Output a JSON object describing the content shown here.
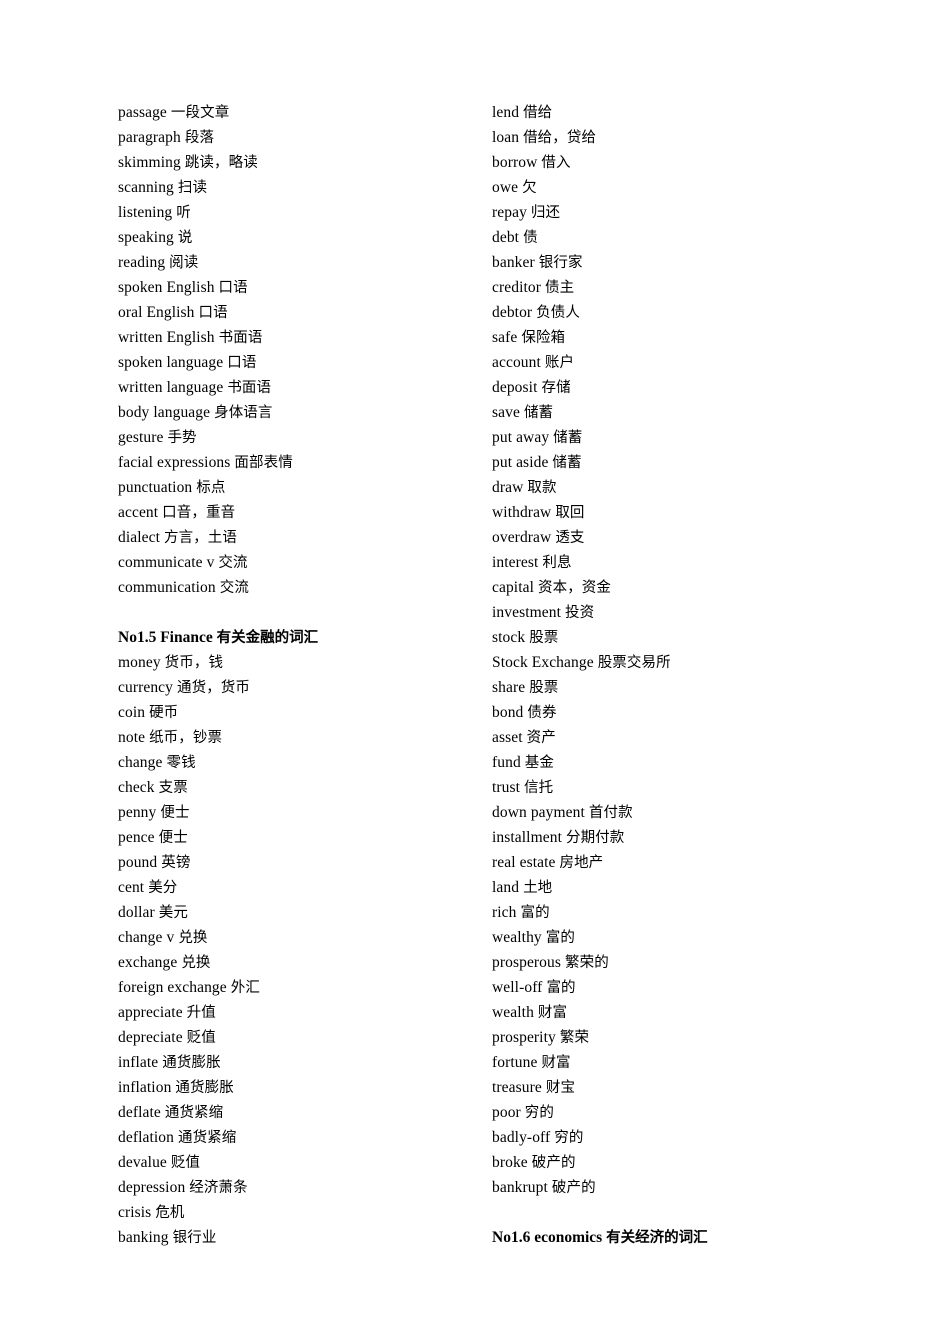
{
  "document": {
    "page_background": "#ffffff",
    "text_color": "#000000",
    "layout": "two-column vocabulary list"
  },
  "left_column": [
    {
      "type": "entry",
      "term": "passage",
      "gloss": "一段文章"
    },
    {
      "type": "entry",
      "term": "paragraph",
      "gloss": "段落"
    },
    {
      "type": "entry",
      "term": "skimming",
      "gloss": "跳读，略读"
    },
    {
      "type": "entry",
      "term": "scanning",
      "gloss": "扫读"
    },
    {
      "type": "entry",
      "term": "listening",
      "gloss": "听"
    },
    {
      "type": "entry",
      "term": "speaking",
      "gloss": "说"
    },
    {
      "type": "entry",
      "term": "reading",
      "gloss": "阅读"
    },
    {
      "type": "entry",
      "term": "spoken English",
      "gloss": "口语"
    },
    {
      "type": "entry",
      "term": "oral English",
      "gloss": "口语"
    },
    {
      "type": "entry",
      "term": "written English",
      "gloss": "书面语"
    },
    {
      "type": "entry",
      "term": "spoken language",
      "gloss": "口语"
    },
    {
      "type": "entry",
      "term": "written language",
      "gloss": "书面语"
    },
    {
      "type": "entry",
      "term": "body language",
      "gloss": "身体语言"
    },
    {
      "type": "entry",
      "term": "gesture",
      "gloss": "手势"
    },
    {
      "type": "entry",
      "term": "facial expressions",
      "gloss": "面部表情"
    },
    {
      "type": "entry",
      "term": "punctuation",
      "gloss": "标点"
    },
    {
      "type": "entry",
      "term": "accent",
      "gloss": "口音，重音"
    },
    {
      "type": "entry",
      "term": "dialect",
      "gloss": "方言，土语"
    },
    {
      "type": "entry",
      "term": "communicate v",
      "gloss": "交流"
    },
    {
      "type": "entry",
      "term": "communication",
      "gloss": "交流"
    },
    {
      "type": "spacer"
    },
    {
      "type": "heading",
      "term": "No1.5 Finance",
      "gloss": "有关金融的词汇"
    },
    {
      "type": "entry",
      "term": "money",
      "gloss": "货币，钱"
    },
    {
      "type": "entry",
      "term": "currency",
      "gloss": "通货，货币"
    },
    {
      "type": "entry",
      "term": "coin",
      "gloss": "硬币"
    },
    {
      "type": "entry",
      "term": "note",
      "gloss": "纸币，钞票"
    },
    {
      "type": "entry",
      "term": "change",
      "gloss": "零钱"
    },
    {
      "type": "entry",
      "term": "check",
      "gloss": "支票"
    },
    {
      "type": "entry",
      "term": "penny",
      "gloss": "便士"
    },
    {
      "type": "entry",
      "term": "pence",
      "gloss": "便士"
    },
    {
      "type": "entry",
      "term": "pound",
      "gloss": "英镑"
    },
    {
      "type": "entry",
      "term": "cent",
      "gloss": "美分"
    },
    {
      "type": "entry",
      "term": "dollar",
      "gloss": "美元"
    },
    {
      "type": "entry",
      "term": "change v",
      "gloss": "兑换"
    },
    {
      "type": "entry",
      "term": "exchange",
      "gloss": "兑换"
    },
    {
      "type": "entry",
      "term": "foreign exchange",
      "gloss": "外汇"
    },
    {
      "type": "entry",
      "term": "appreciate",
      "gloss": "升值"
    },
    {
      "type": "entry",
      "term": "depreciate",
      "gloss": "贬值"
    },
    {
      "type": "entry",
      "term": "inflate",
      "gloss": "通货膨胀"
    },
    {
      "type": "entry",
      "term": "inflation",
      "gloss": "通货膨胀"
    },
    {
      "type": "entry",
      "term": "deflate",
      "gloss": "通货紧缩"
    },
    {
      "type": "entry",
      "term": "deflation",
      "gloss": "通货紧缩"
    },
    {
      "type": "entry",
      "term": "devalue",
      "gloss": "贬值"
    },
    {
      "type": "entry",
      "term": "depression",
      "gloss": "经济萧条"
    },
    {
      "type": "entry",
      "term": "crisis",
      "gloss": "危机"
    },
    {
      "type": "entry",
      "term": "banking",
      "gloss": "银行业"
    }
  ],
  "right_column": [
    {
      "type": "entry",
      "term": "lend",
      "gloss": "借给"
    },
    {
      "type": "entry",
      "term": "loan",
      "gloss": "借给，贷给"
    },
    {
      "type": "entry",
      "term": "borrow",
      "gloss": "借入"
    },
    {
      "type": "entry",
      "term": "owe",
      "gloss": "欠"
    },
    {
      "type": "entry",
      "term": "repay",
      "gloss": "归还"
    },
    {
      "type": "entry",
      "term": "debt",
      "gloss": "债"
    },
    {
      "type": "entry",
      "term": "banker",
      "gloss": "银行家"
    },
    {
      "type": "entry",
      "term": "creditor",
      "gloss": "债主"
    },
    {
      "type": "entry",
      "term": "debtor",
      "gloss": "负债人"
    },
    {
      "type": "entry",
      "term": "safe",
      "gloss": "保险箱"
    },
    {
      "type": "entry",
      "term": "account",
      "gloss": "账户"
    },
    {
      "type": "entry",
      "term": "deposit",
      "gloss": "存储"
    },
    {
      "type": "entry",
      "term": "save",
      "gloss": "储蓄"
    },
    {
      "type": "entry",
      "term": "put away",
      "gloss": "储蓄"
    },
    {
      "type": "entry",
      "term": "put aside",
      "gloss": "储蓄"
    },
    {
      "type": "entry",
      "term": "draw",
      "gloss": "取款"
    },
    {
      "type": "entry",
      "term": "withdraw",
      "gloss": "取回"
    },
    {
      "type": "entry",
      "term": "overdraw",
      "gloss": "透支"
    },
    {
      "type": "entry",
      "term": "interest",
      "gloss": "利息"
    },
    {
      "type": "entry",
      "term": "capital",
      "gloss": "资本，资金"
    },
    {
      "type": "entry",
      "term": "investment",
      "gloss": "投资"
    },
    {
      "type": "entry",
      "term": "stock",
      "gloss": "股票"
    },
    {
      "type": "entry",
      "term": "Stock Exchange",
      "gloss": "股票交易所"
    },
    {
      "type": "entry",
      "term": "share",
      "gloss": "股票"
    },
    {
      "type": "entry",
      "term": "bond",
      "gloss": "债券"
    },
    {
      "type": "entry",
      "term": "asset",
      "gloss": "资产"
    },
    {
      "type": "entry",
      "term": "fund",
      "gloss": "基金"
    },
    {
      "type": "entry",
      "term": "trust",
      "gloss": "信托"
    },
    {
      "type": "entry",
      "term": "down payment",
      "gloss": "首付款"
    },
    {
      "type": "entry",
      "term": "installment",
      "gloss": "分期付款"
    },
    {
      "type": "entry",
      "term": "real estate",
      "gloss": "房地产"
    },
    {
      "type": "entry",
      "term": "land",
      "gloss": "土地"
    },
    {
      "type": "entry",
      "term": "rich",
      "gloss": "富的"
    },
    {
      "type": "entry",
      "term": "wealthy",
      "gloss": "富的"
    },
    {
      "type": "entry",
      "term": "prosperous",
      "gloss": "繁荣的"
    },
    {
      "type": "entry",
      "term": "well-off",
      "gloss": "富的"
    },
    {
      "type": "entry",
      "term": "wealth",
      "gloss": "财富"
    },
    {
      "type": "entry",
      "term": "prosperity",
      "gloss": "繁荣"
    },
    {
      "type": "entry",
      "term": "fortune",
      "gloss": "财富"
    },
    {
      "type": "entry",
      "term": "treasure",
      "gloss": "财宝"
    },
    {
      "type": "entry",
      "term": "poor",
      "gloss": "穷的"
    },
    {
      "type": "entry",
      "term": "badly-off",
      "gloss": "穷的"
    },
    {
      "type": "entry",
      "term": "broke",
      "gloss": "破产的"
    },
    {
      "type": "entry",
      "term": "bankrupt",
      "gloss": "破产的"
    },
    {
      "type": "spacer"
    },
    {
      "type": "heading",
      "term": "No1.6 economics",
      "gloss": "有关经济的词汇"
    }
  ]
}
